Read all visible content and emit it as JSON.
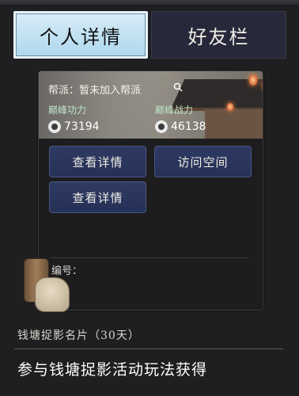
{
  "tabs": {
    "profile_label": "个人详情",
    "friends_label": "好友栏"
  },
  "card": {
    "guild_text": "帮派：暂未加入帮派",
    "stats": {
      "power_label": "巅峰功力",
      "power_value": "73194",
      "combat_label": "巅峰战力",
      "combat_value": "46138"
    },
    "buttons": {
      "view_details_1": "查看详情",
      "visit_space": "访问空间",
      "view_details_2": "查看详情"
    },
    "id_label": "编号："
  },
  "item": {
    "name": "钱塘捉影名片（30天）",
    "description": "参与钱塘捉影活动玩法获得"
  },
  "icons": {
    "search": "search-icon",
    "power": "power-icon",
    "combat": "combat-icon"
  },
  "colors": {
    "active_tab": "#aed8ee",
    "button": "#2b355c",
    "background": "#1f1f21"
  }
}
